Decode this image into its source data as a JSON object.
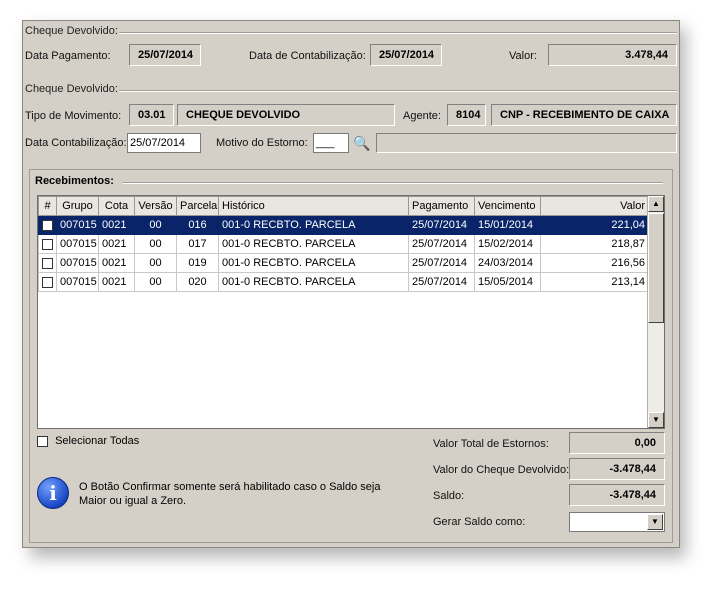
{
  "section1": {
    "title": "Cheque Devolvido:",
    "data_pagamento_label": "Data Pagamento:",
    "data_pagamento_value": "25/07/2014",
    "data_contabilizacao_label": "Data de Contabilização:",
    "data_contabilizacao_value": "25/07/2014",
    "valor_label": "Valor:",
    "valor_value": "3.478,44"
  },
  "section2": {
    "title": "Cheque Devolvido:",
    "tipo_movimento_label": "Tipo de Movimento:",
    "tipo_movimento_code": "03.01",
    "tipo_movimento_desc": "CHEQUE DEVOLVIDO",
    "agente_label": "Agente:",
    "agente_code": "8104",
    "agente_desc": "CNP - RECEBIMENTO DE CAIXA",
    "data_contab_label": "Data Contabilização:",
    "data_contab_value": "25/07/2014",
    "motivo_label": "Motivo do Estorno:",
    "motivo_value": "___",
    "motivo_desc": ""
  },
  "recebimentos": {
    "title": "Recebimentos:",
    "columns": [
      "#",
      "Grupo",
      "Cota",
      "Versão",
      "Parcela",
      "Histórico",
      "Pagamento",
      "Vencimento",
      "Valor"
    ],
    "rows": [
      {
        "grupo": "007015",
        "cota": "0021",
        "versao": "00",
        "parcela": "016",
        "historico": "001-0 RECBTO. PARCELA",
        "pagamento": "25/07/2014",
        "vencimento": "15/01/2014",
        "valor": "221,04"
      },
      {
        "grupo": "007015",
        "cota": "0021",
        "versao": "00",
        "parcela": "017",
        "historico": "001-0 RECBTO. PARCELA",
        "pagamento": "25/07/2014",
        "vencimento": "15/02/2014",
        "valor": "218,87"
      },
      {
        "grupo": "007015",
        "cota": "0021",
        "versao": "00",
        "parcela": "019",
        "historico": "001-0 RECBTO. PARCELA",
        "pagamento": "25/07/2014",
        "vencimento": "24/03/2014",
        "valor": "216,56"
      },
      {
        "grupo": "007015",
        "cota": "0021",
        "versao": "00",
        "parcela": "020",
        "historico": "001-0 RECBTO. PARCELA",
        "pagamento": "25/07/2014",
        "vencimento": "15/05/2014",
        "valor": "213,14"
      }
    ],
    "selected_row": 0,
    "selecionar_todas_label": "Selecionar Todas"
  },
  "info": {
    "icon": "info-icon",
    "message_line1": "O Botão Confirmar somente será habilitado caso o Saldo seja",
    "message_line2": "Maior ou igual a Zero."
  },
  "totals": {
    "valor_total_estornos_label": "Valor Total de Estornos:",
    "valor_total_estornos_value": "0,00",
    "valor_cheque_label": "Valor do Cheque Devolvido:",
    "valor_cheque_value": "-3.478,44",
    "saldo_label": "Saldo:",
    "saldo_value": "-3.478,44",
    "gerar_saldo_label": "Gerar Saldo como:",
    "gerar_saldo_value": ""
  },
  "colors": {
    "panel_bg": "#d4d0c8",
    "selection": "#0a246a"
  }
}
